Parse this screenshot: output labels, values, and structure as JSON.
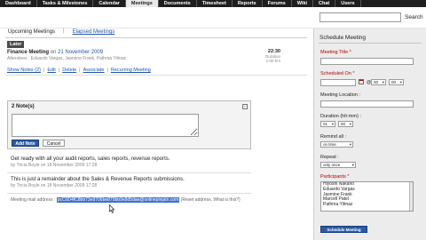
{
  "nav": {
    "tabs": [
      "Dashboard",
      "Tasks & Milestones",
      "Calendar",
      "Meetings",
      "Documents",
      "Timesheet",
      "Reports",
      "Forums",
      "Wiki",
      "Chat",
      "Users"
    ],
    "active_index": 3
  },
  "search": {
    "value": "",
    "button_label": "Search"
  },
  "subtabs": {
    "upcoming": "Upcoming Meetings",
    "separator": "|",
    "elapsed": "Elapsed Meetings"
  },
  "meeting": {
    "badge": "Later",
    "title": "Finance Meeting",
    "on_label": "on",
    "date": "21 November 2009",
    "attendees": "Attendees : Eduardo Vargas, Jasmine Frank, Pathma Yilmaz",
    "time": "22:30",
    "time_sub1": "Duration",
    "time_sub2": "1:00 hrs",
    "actions": [
      "Show Notes (2)",
      "Edit",
      "Delete",
      "Associate",
      "Recurring Meeting"
    ]
  },
  "notes": {
    "header": "2 Note(s)",
    "icon_label": "i",
    "add_button": "Add Note",
    "cancel_button": "Cancel",
    "items": [
      {
        "text": "Get ready with all your audit reports, sales reports, revenue reports.",
        "by": "by Tricia Boyle  on 18 November 2009 17:28"
      },
      {
        "text": "This is just a remainder about the Sales & Revenue Reports submissions.",
        "by": "by Tricia Boyle  on 18 November 2009 17:28"
      }
    ]
  },
  "mail": {
    "prefix": "Meeting mail address : ",
    "address": "pcC0D4fC8bb73e8706be870bb9e8d5dae@onlinepinjatn.com",
    "suffix": " (Reset address.  What is this?)"
  },
  "side": {
    "title": "Schedule Meeting",
    "meeting_title_label": "Meeting Title",
    "scheduled_on_label": "Scheduled On",
    "at_label": "@",
    "hour_value": "00",
    "minute_value": "00",
    "location_label": "Meeting Location :",
    "duration_label": "Duration (hh:mm) :",
    "duration_h": "01",
    "duration_m": "00",
    "remind_label": "Remind all :",
    "remind_value": "on time",
    "repeat_label": "Repeat :",
    "repeat_value": "only once",
    "participants_label": "Participants",
    "participants": [
      "Hiyoshi Nakano",
      "Eduardo Vargas",
      "Jasmine Frank",
      "Marcell Patel",
      "Pathma Yilmaz"
    ],
    "schedule_button": "Schedule Meeting",
    "req_mark": "*"
  },
  "colors": {
    "accent": "#2a5aa8",
    "nav_bg": "#1e1e1e",
    "link": "#2255aa",
    "required": "#b00000"
  }
}
